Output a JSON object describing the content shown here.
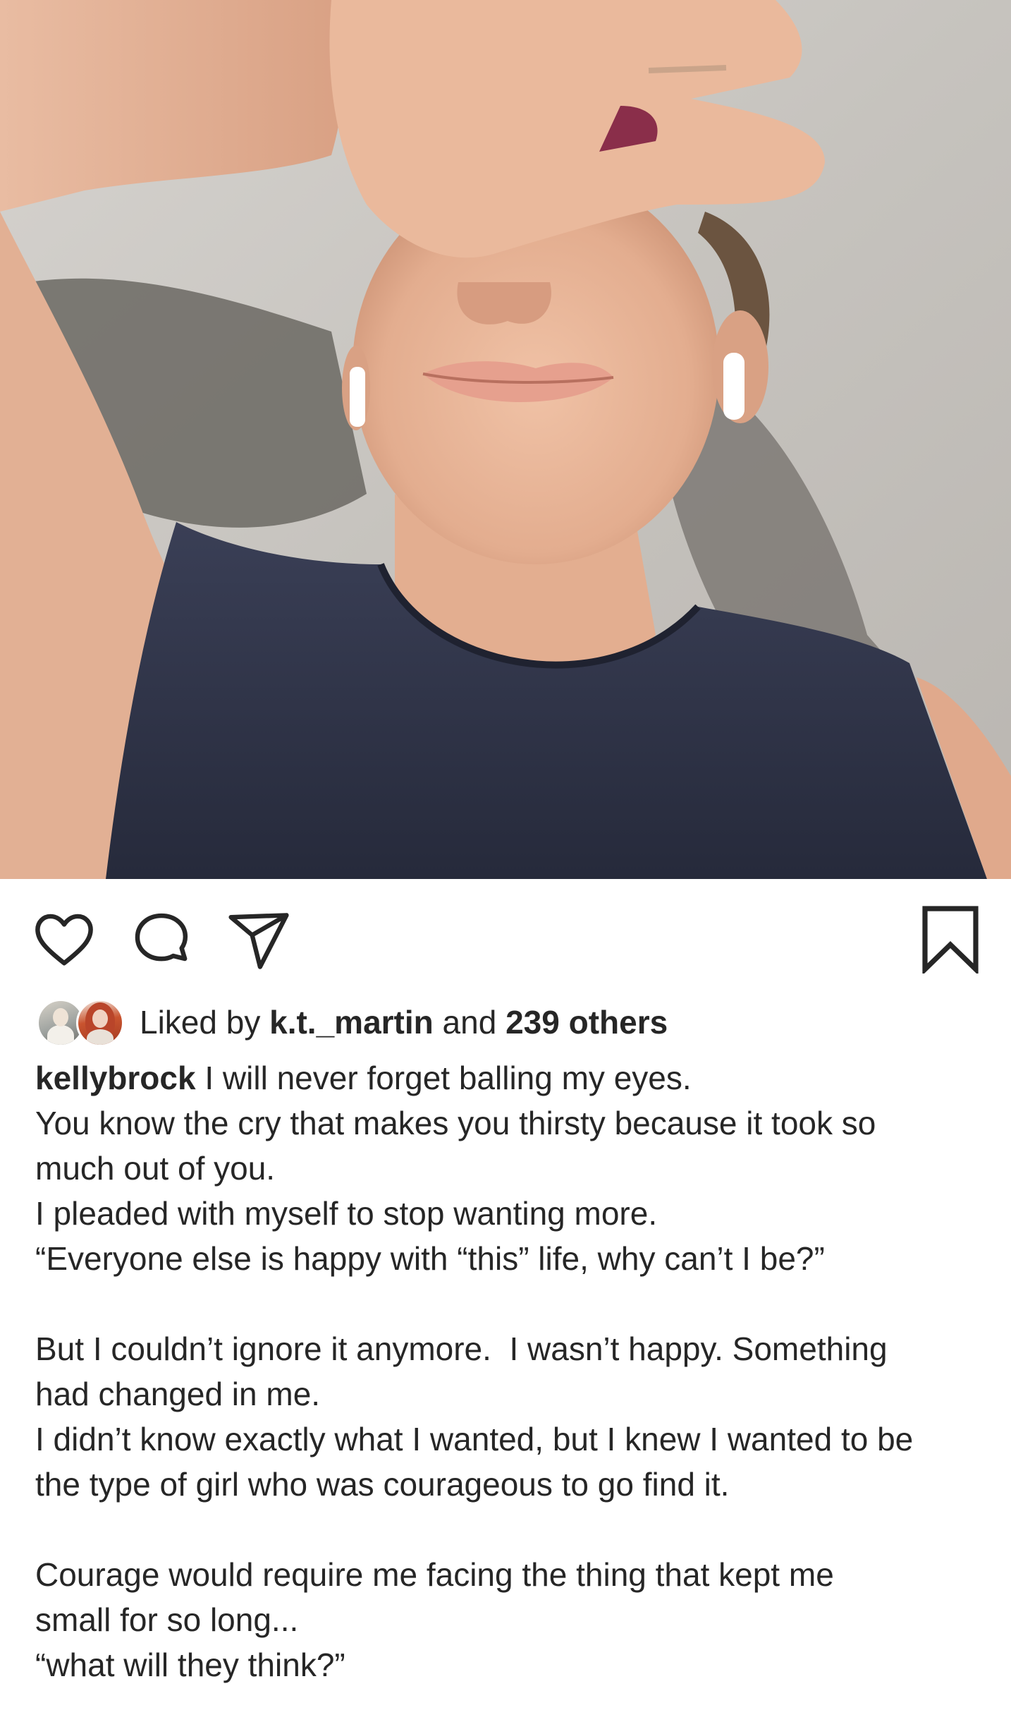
{
  "post": {
    "actions": {
      "like_icon": "heart-outline-icon",
      "comment_icon": "speech-bubble-icon",
      "share_icon": "paper-plane-icon",
      "save_icon": "bookmark-outline-icon"
    },
    "likes": {
      "prefix": "Liked by",
      "liker": "k.t._martin",
      "connector": "and",
      "others": "239 others"
    },
    "caption": {
      "username": "kellybrock",
      "first_line": "I will never forget balling my eyes.",
      "lines": [
        "You know the cry that makes you thirsty because it took so",
        "much out of you.",
        "I pleaded with myself to stop wanting more.",
        "“Everyone else is happy with “this” life, why can’t I be?”",
        "",
        "But I couldn’t ignore it anymore.  I wasn’t happy. Something",
        "had changed in me.",
        "I didn’t know exactly what I wanted, but I knew I wanted to be",
        "the type of girl who was courageous to go find it.",
        "",
        "Courage would require me facing the thing that kept me",
        "small for so long...",
        "“what will they think?”"
      ]
    }
  },
  "colors": {
    "text": "#262626",
    "icon": "#262626",
    "background": "#ffffff",
    "shirt": "#2f3346",
    "skin": "#e8b79c",
    "pavement": "#c9c6c2"
  }
}
